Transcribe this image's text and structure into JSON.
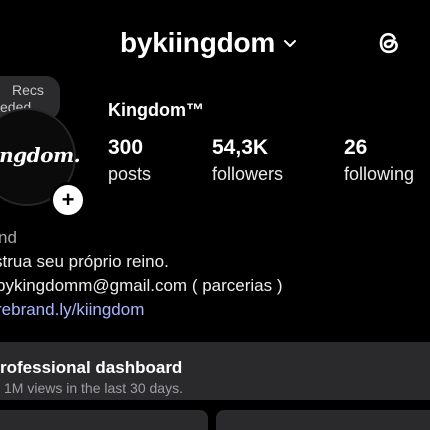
{
  "header": {
    "username": "bykiingdom",
    "chevron_icon": "chevron-down-icon",
    "threads_icon": "threads-icon"
  },
  "recs": {
    "line1": "Recs",
    "line2": "eded..."
  },
  "profile": {
    "avatar_text": "ingdom.",
    "add_icon_glyph": "+",
    "display_name": "Kingdom™"
  },
  "stats": {
    "posts": {
      "count": "300",
      "label": "posts"
    },
    "followers": {
      "count": "54,3K",
      "label": "followers"
    },
    "following": {
      "count": "26",
      "label": "following"
    }
  },
  "bio": {
    "category": "nd",
    "line1": "strua seu próprio reino.",
    "line2": "bykingdomm@gmail.com ( parcerias )",
    "link": "rebrand.ly/kiingdom"
  },
  "dashboard": {
    "title": "rofessional dashboard",
    "subtitle": "1M views in the last 30 days."
  },
  "colors": {
    "background": "#000000",
    "panel": "#2a2a2c",
    "link": "#a7b6ff",
    "muted": "#a8a8a8"
  }
}
